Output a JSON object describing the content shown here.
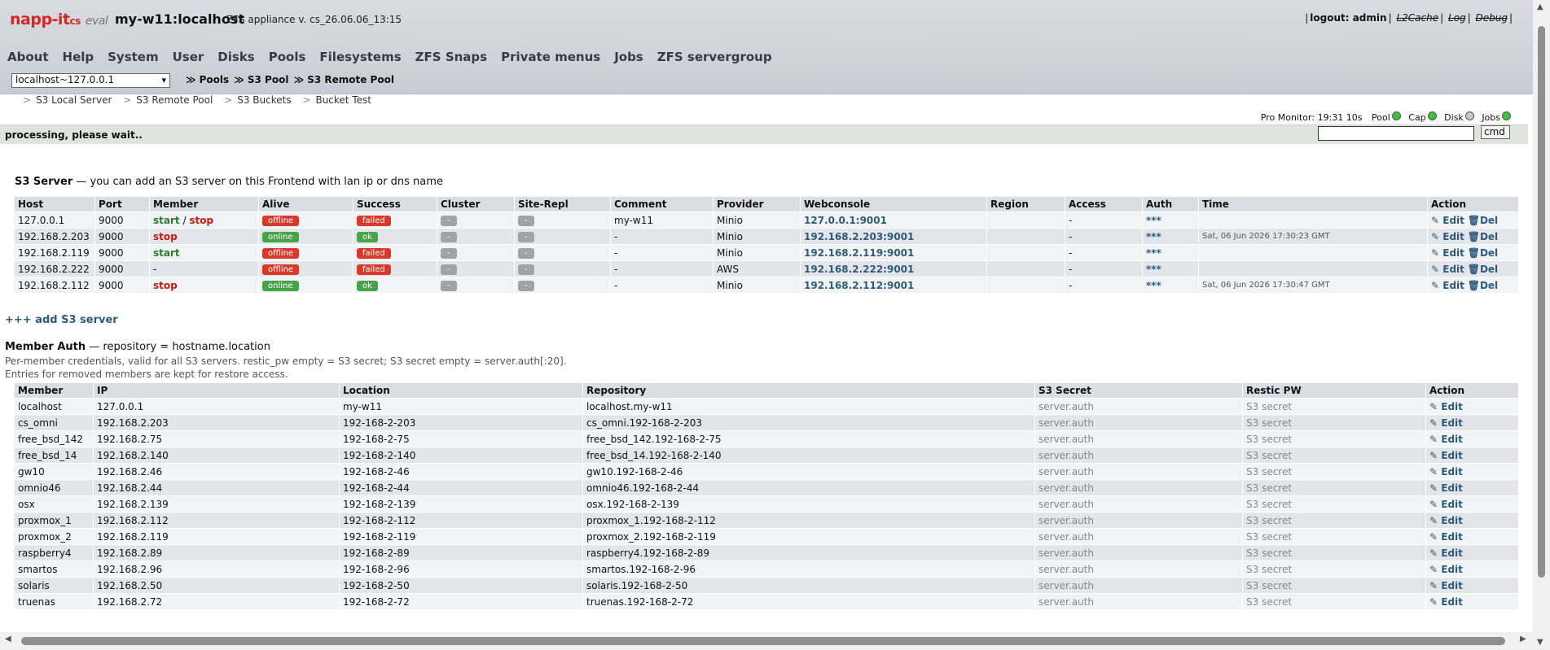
{
  "header": {
    "logo_main": "napp-it",
    "logo_cs": "cs",
    "logo_eval": "eval",
    "host_title": "my-w11:localhost",
    "version": "ZFS appliance v. cs_26.06.06_13:15",
    "top_links": {
      "logout": "logout: admin",
      "l2cache": "L2Cache",
      "log": "Log",
      "debug": "Debug"
    }
  },
  "menu": [
    "About",
    "Help",
    "System",
    "User",
    "Disks",
    "Pools",
    "Filesystems",
    "ZFS Snaps",
    "Private menus",
    "Jobs",
    "ZFS servergroup"
  ],
  "host_select": {
    "value": "localhost~127.0.0.1"
  },
  "breadcrumb": [
    "Pools",
    "S3 Pool",
    "S3 Remote Pool"
  ],
  "subnav": [
    "S3 Local Server",
    "S3 Remote Pool",
    "S3 Buckets",
    "Bucket Test"
  ],
  "monitor": {
    "label": "Pro Monitor: 19:31 10s",
    "items": [
      {
        "label": "Pool",
        "color": "#3fbf3f"
      },
      {
        "label": "Cap",
        "color": "#3fbf3f"
      },
      {
        "label": "Disk",
        "color": "#c8c8c8"
      },
      {
        "label": "Jobs",
        "color": "#3fbf3f"
      }
    ]
  },
  "processing": "processing, please wait..",
  "cmd": {
    "button": "cmd",
    "value": ""
  },
  "s3": {
    "title": "S3 Server",
    "subtitle": " — you can add an S3 server on this Frontend with lan ip or dns name",
    "columns": [
      "Host",
      "Port",
      "Member",
      "Alive",
      "Success",
      "Cluster",
      "Site-Repl",
      "Comment",
      "Provider",
      "Webconsole",
      "Region",
      "Access",
      "Auth",
      "Time",
      "Action"
    ],
    "rows": [
      {
        "host": "127.0.0.1",
        "port": "9000",
        "member": "start / stop",
        "alive": "offline",
        "success": "failed",
        "cluster": "-",
        "site_repl": "-",
        "comment": "my-w11",
        "provider": "Minio",
        "webconsole": "127.0.0.1:9001",
        "region": "",
        "access": "-",
        "auth": "***",
        "time": ""
      },
      {
        "host": "192.168.2.203",
        "port": "9000",
        "member": "stop",
        "alive": "online",
        "success": "ok",
        "cluster": "-",
        "site_repl": "-",
        "comment": "-",
        "provider": "Minio",
        "webconsole": "192.168.2.203:9001",
        "region": "",
        "access": "-",
        "auth": "***",
        "time": "Sat, 06 Jun 2026 17:30:23 GMT"
      },
      {
        "host": "192.168.2.119",
        "port": "9000",
        "member": "start",
        "alive": "offline",
        "success": "failed",
        "cluster": "-",
        "site_repl": "-",
        "comment": "-",
        "provider": "Minio",
        "webconsole": "192.168.2.119:9001",
        "region": "",
        "access": "-",
        "auth": "***",
        "time": ""
      },
      {
        "host": "192.168.2.222",
        "port": "9000",
        "member": "-",
        "alive": "offline",
        "success": "failed",
        "cluster": "-",
        "site_repl": "-",
        "comment": "-",
        "provider": "AWS",
        "webconsole": "192.168.2.222:9001",
        "region": "",
        "access": "-",
        "auth": "***",
        "time": ""
      },
      {
        "host": "192.168.2.112",
        "port": "9000",
        "member": "stop",
        "alive": "online",
        "success": "ok",
        "cluster": "-",
        "site_repl": "-",
        "comment": "-",
        "provider": "Minio",
        "webconsole": "192.168.2.112:9001",
        "region": "",
        "access": "-",
        "auth": "***",
        "time": "Sat, 06 Jun 2026 17:30:47 GMT"
      }
    ],
    "edit_label": "Edit",
    "del_label": "Del",
    "add_label": "+++ add S3 server"
  },
  "member_auth": {
    "title": "Member Auth",
    "subtitle": " — repository = hostname.location",
    "note1": "Per-member credentials, valid for all S3 servers. restic_pw empty = S3 secret; S3 secret empty = server.auth[:20].",
    "note2": "Entries for removed members are kept for restore access.",
    "columns": [
      "Member",
      "IP",
      "Location",
      "Repository",
      "S3 Secret",
      "Restic PW",
      "Action"
    ],
    "rows": [
      {
        "member": "localhost",
        "ip": "127.0.0.1",
        "location": "my-w11",
        "repository": "localhost.my-w11",
        "secret": "server.auth",
        "restic": "S3 secret"
      },
      {
        "member": "cs_omni",
        "ip": "192.168.2.203",
        "location": "192-168-2-203",
        "repository": "cs_omni.192-168-2-203",
        "secret": "server.auth",
        "restic": "S3 secret"
      },
      {
        "member": "free_bsd_142",
        "ip": "192.168.2.75",
        "location": "192-168-2-75",
        "repository": "free_bsd_142.192-168-2-75",
        "secret": "server.auth",
        "restic": "S3 secret"
      },
      {
        "member": "free_bsd_14",
        "ip": "192.168.2.140",
        "location": "192-168-2-140",
        "repository": "free_bsd_14.192-168-2-140",
        "secret": "server.auth",
        "restic": "S3 secret"
      },
      {
        "member": "gw10",
        "ip": "192.168.2.46",
        "location": "192-168-2-46",
        "repository": "gw10.192-168-2-46",
        "secret": "server.auth",
        "restic": "S3 secret"
      },
      {
        "member": "omnio46",
        "ip": "192.168.2.44",
        "location": "192-168-2-44",
        "repository": "omnio46.192-168-2-44",
        "secret": "server.auth",
        "restic": "S3 secret"
      },
      {
        "member": "osx",
        "ip": "192.168.2.139",
        "location": "192-168-2-139",
        "repository": "osx.192-168-2-139",
        "secret": "server.auth",
        "restic": "S3 secret"
      },
      {
        "member": "proxmox_1",
        "ip": "192.168.2.112",
        "location": "192-168-2-112",
        "repository": "proxmox_1.192-168-2-112",
        "secret": "server.auth",
        "restic": "S3 secret"
      },
      {
        "member": "proxmox_2",
        "ip": "192.168.2.119",
        "location": "192-168-2-119",
        "repository": "proxmox_2.192-168-2-119",
        "secret": "server.auth",
        "restic": "S3 secret"
      },
      {
        "member": "raspberry4",
        "ip": "192.168.2.89",
        "location": "192-168-2-89",
        "repository": "raspberry4.192-168-2-89",
        "secret": "server.auth",
        "restic": "S3 secret"
      },
      {
        "member": "smartos",
        "ip": "192.168.2.96",
        "location": "192-168-2-96",
        "repository": "smartos.192-168-2-96",
        "secret": "server.auth",
        "restic": "S3 secret"
      },
      {
        "member": "solaris",
        "ip": "192.168.2.50",
        "location": "192-168-2-50",
        "repository": "solaris.192-168-2-50",
        "secret": "server.auth",
        "restic": "S3 secret"
      },
      {
        "member": "truenas",
        "ip": "192.168.2.72",
        "location": "192-168-2-72",
        "repository": "truenas.192-168-2-72",
        "secret": "server.auth",
        "restic": "S3 secret"
      }
    ],
    "edit_label": "Edit"
  }
}
